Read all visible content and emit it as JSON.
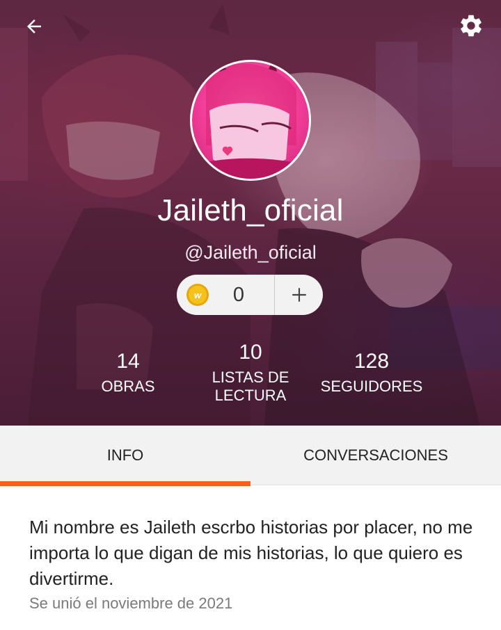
{
  "header": {
    "back_icon": "arrow-left-icon",
    "settings_icon": "gear-icon",
    "username": "Jaileth_oficial",
    "handle": "@Jaileth_oficial",
    "coins": {
      "icon": "wattpad-coin-icon",
      "value": "0",
      "add_icon": "plus-icon"
    },
    "stats": {
      "works": {
        "value": "14",
        "label": "OBRAS"
      },
      "reading_lists": {
        "value": "10",
        "label": "LISTAS DE LECTURA"
      },
      "followers": {
        "value": "128",
        "label": "SEGUIDORES"
      }
    }
  },
  "tabs": [
    {
      "label": "INFO",
      "active": true
    },
    {
      "label": "CONVERSACIONES",
      "active": false
    }
  ],
  "info": {
    "bio": "Mi nombre es Jaileth escrbo historias por placer, no me importa lo que digan de mis historias, lo que quiero es divertirme.",
    "joined": "Se unió el noviembre de 2021"
  },
  "colors": {
    "accent": "#ff5d1f",
    "header_bg": "#5e2742",
    "avatar_bg": "#f13c97",
    "tab_bg": "#f2f2f2",
    "coin": "#f5c21b"
  }
}
